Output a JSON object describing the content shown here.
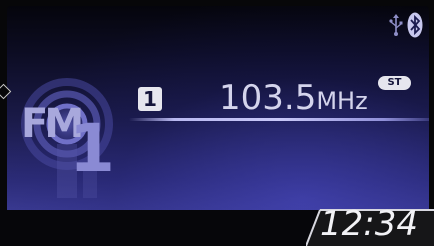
{
  "status": {
    "usb_icon": "usb-icon",
    "bluetooth_icon": "bluetooth-icon"
  },
  "radio": {
    "band": "FM",
    "band_number": "1",
    "preset": "1",
    "frequency_value": "103.5",
    "frequency_unit": "MHz",
    "stereo_badge": "ST"
  },
  "clock": {
    "time": "12:34"
  },
  "colors": {
    "screen_accent": "#2c2c78",
    "text_light": "#d4d4ec",
    "logo_tint": "#8a8ad4"
  }
}
